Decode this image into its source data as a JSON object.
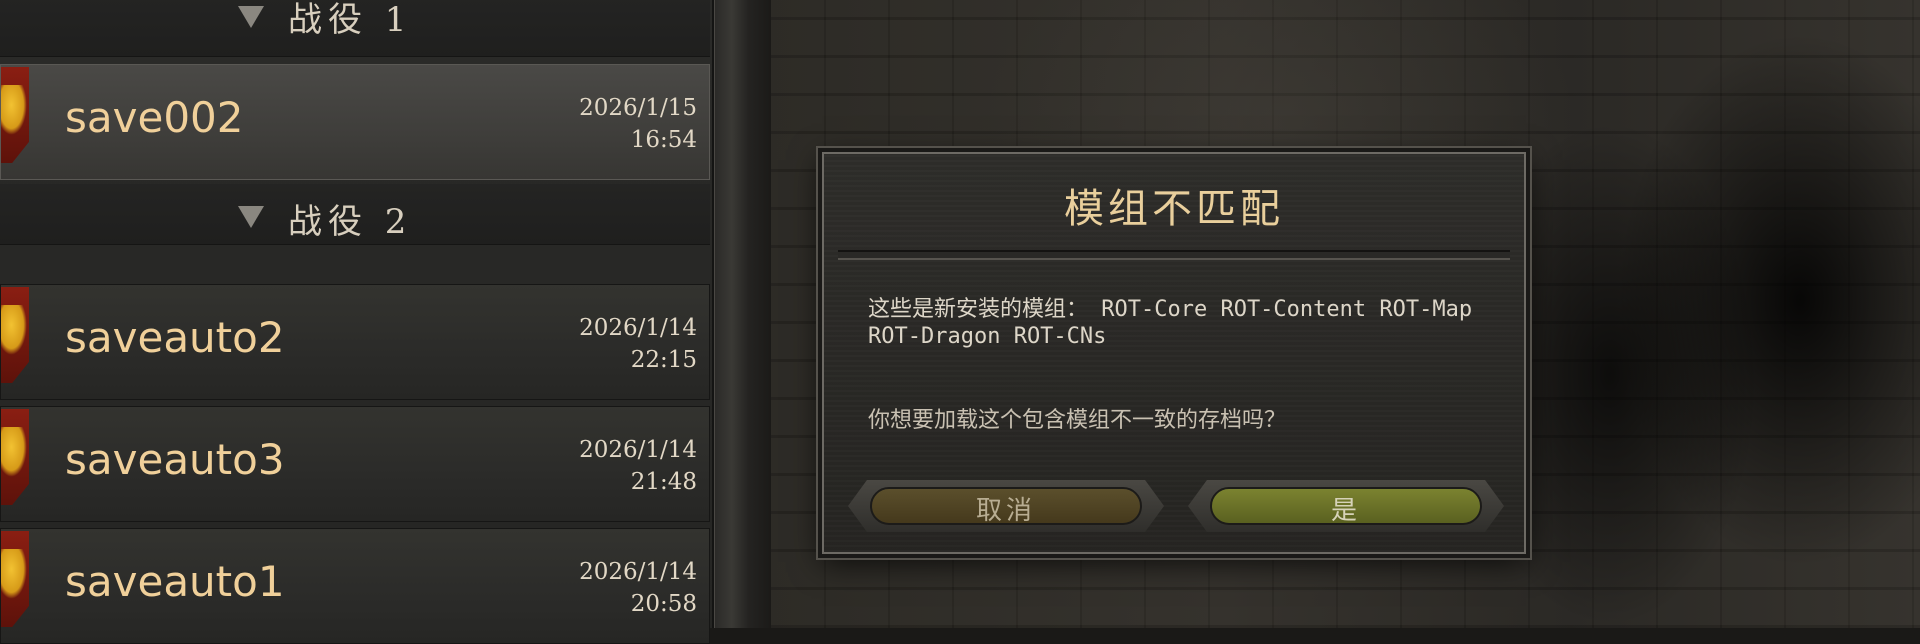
{
  "save_list": {
    "groups": [
      {
        "label": "战役 1"
      },
      {
        "label": "战役 2"
      }
    ],
    "saves": [
      {
        "name": "save002",
        "date": "2026/1/15",
        "time": "16:54",
        "selected": true
      },
      {
        "name": "saveauto2",
        "date": "2026/1/14",
        "time": "22:15",
        "selected": false
      },
      {
        "name": "saveauto3",
        "date": "2026/1/14",
        "time": "21:48",
        "selected": false
      },
      {
        "name": "saveauto1",
        "date": "2026/1/14",
        "time": "20:58",
        "selected": false
      }
    ]
  },
  "dialog": {
    "title": "模组不匹配",
    "message": "这些是新安装的模组： ROT-Core ROT-Content ROT-Map ROT-Dragon ROT-CNs",
    "question": "你想要加载这个包含模组不一致的存档吗？",
    "cancel_label": "取消",
    "confirm_label": "是"
  },
  "colors": {
    "accent_text": "#f0d09a",
    "cancel_button": "#5b4f2c",
    "confirm_button": "#7b8330",
    "shield": "#8a1e12",
    "eagle": "#f2c232"
  },
  "icons": [
    "dropdown-triangle-icon",
    "faction-shield-icon"
  ]
}
